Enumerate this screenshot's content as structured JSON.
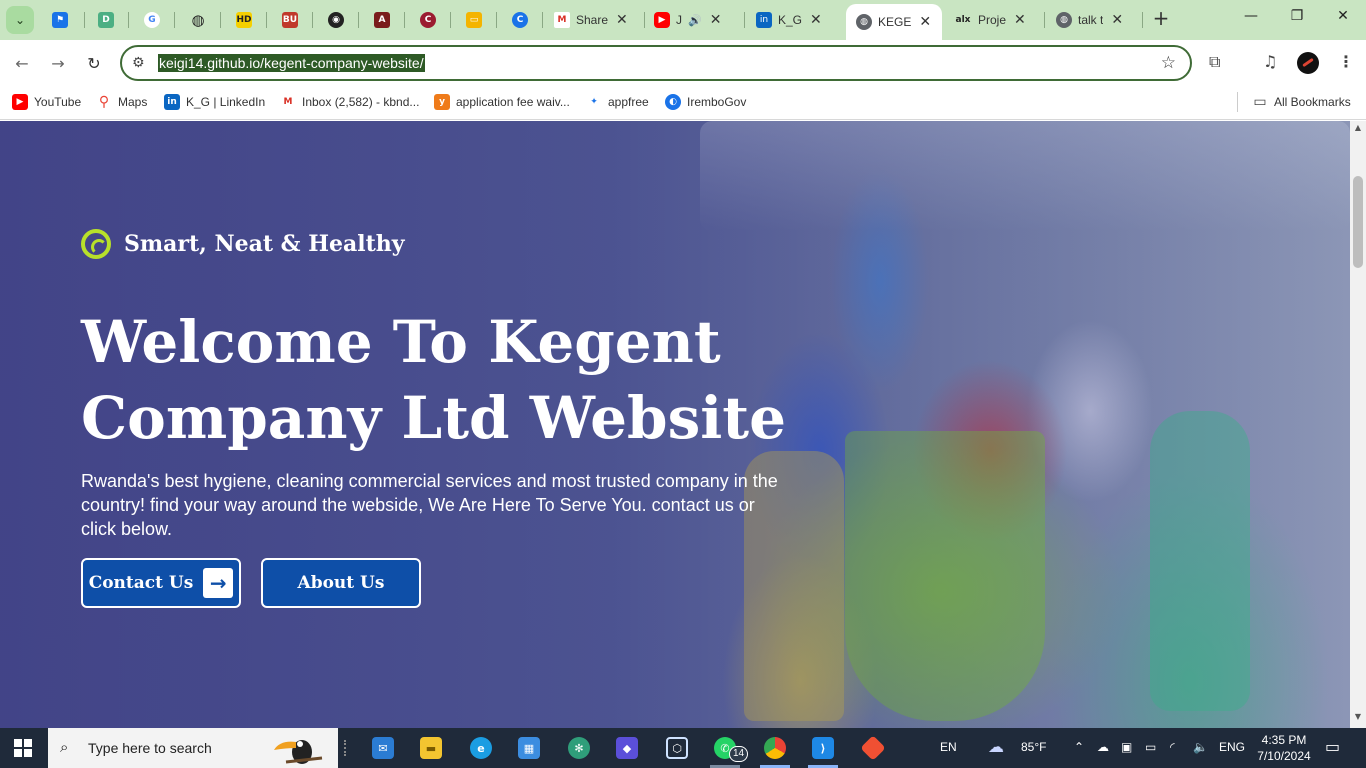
{
  "browser": {
    "tabs": [
      {
        "title": "Share",
        "type": "gmail"
      },
      {
        "title": "J",
        "type": "youtube",
        "audio": true
      },
      {
        "title": "K_G",
        "type": "linkedin"
      },
      {
        "title": "KEGE",
        "type": "web",
        "active": true
      },
      {
        "title": "Proje",
        "type": "alx"
      },
      {
        "title": "talk t",
        "type": "web"
      }
    ],
    "pinned_icons": [
      "tab-flag-icon",
      "tab-d-icon",
      "google-icon",
      "globe-icon",
      "hd-icon",
      "bu-icon",
      "github-icon",
      "a-icon",
      "c-icon",
      "slides-icon",
      "chrome-icon"
    ],
    "url": "keigi14.github.io/kegent-company-website/",
    "bookmarks": [
      {
        "label": "YouTube"
      },
      {
        "label": "Maps"
      },
      {
        "label": "K_G | LinkedIn"
      },
      {
        "label": "Inbox (2,582) - kbnd..."
      },
      {
        "label": "application fee waiv..."
      },
      {
        "label": "appfree"
      },
      {
        "label": "IremboGov"
      }
    ],
    "all_bookmarks": "All Bookmarks",
    "accent": "#c9e5c2"
  },
  "page": {
    "tagline": "Smart, Neat & Healthy",
    "title": "Welcome To Kegent Company Ltd Website",
    "description": "Rwanda's best hygiene, cleaning commercial services and most trusted company in the country! find your way around the webside, We Are Here To Serve You. contact us or click below.",
    "contact_label": "Contact Us",
    "about_label": "About Us",
    "button_color": "#0e4fa8",
    "tag_icon_color": "#b8e02a"
  },
  "taskbar": {
    "search_placeholder": "Type here to search",
    "whatsapp_badge": "14",
    "lang_short": "EN",
    "weather": "85°F",
    "lang": "ENG",
    "time": "4:35 PM",
    "date": "7/10/2024"
  }
}
